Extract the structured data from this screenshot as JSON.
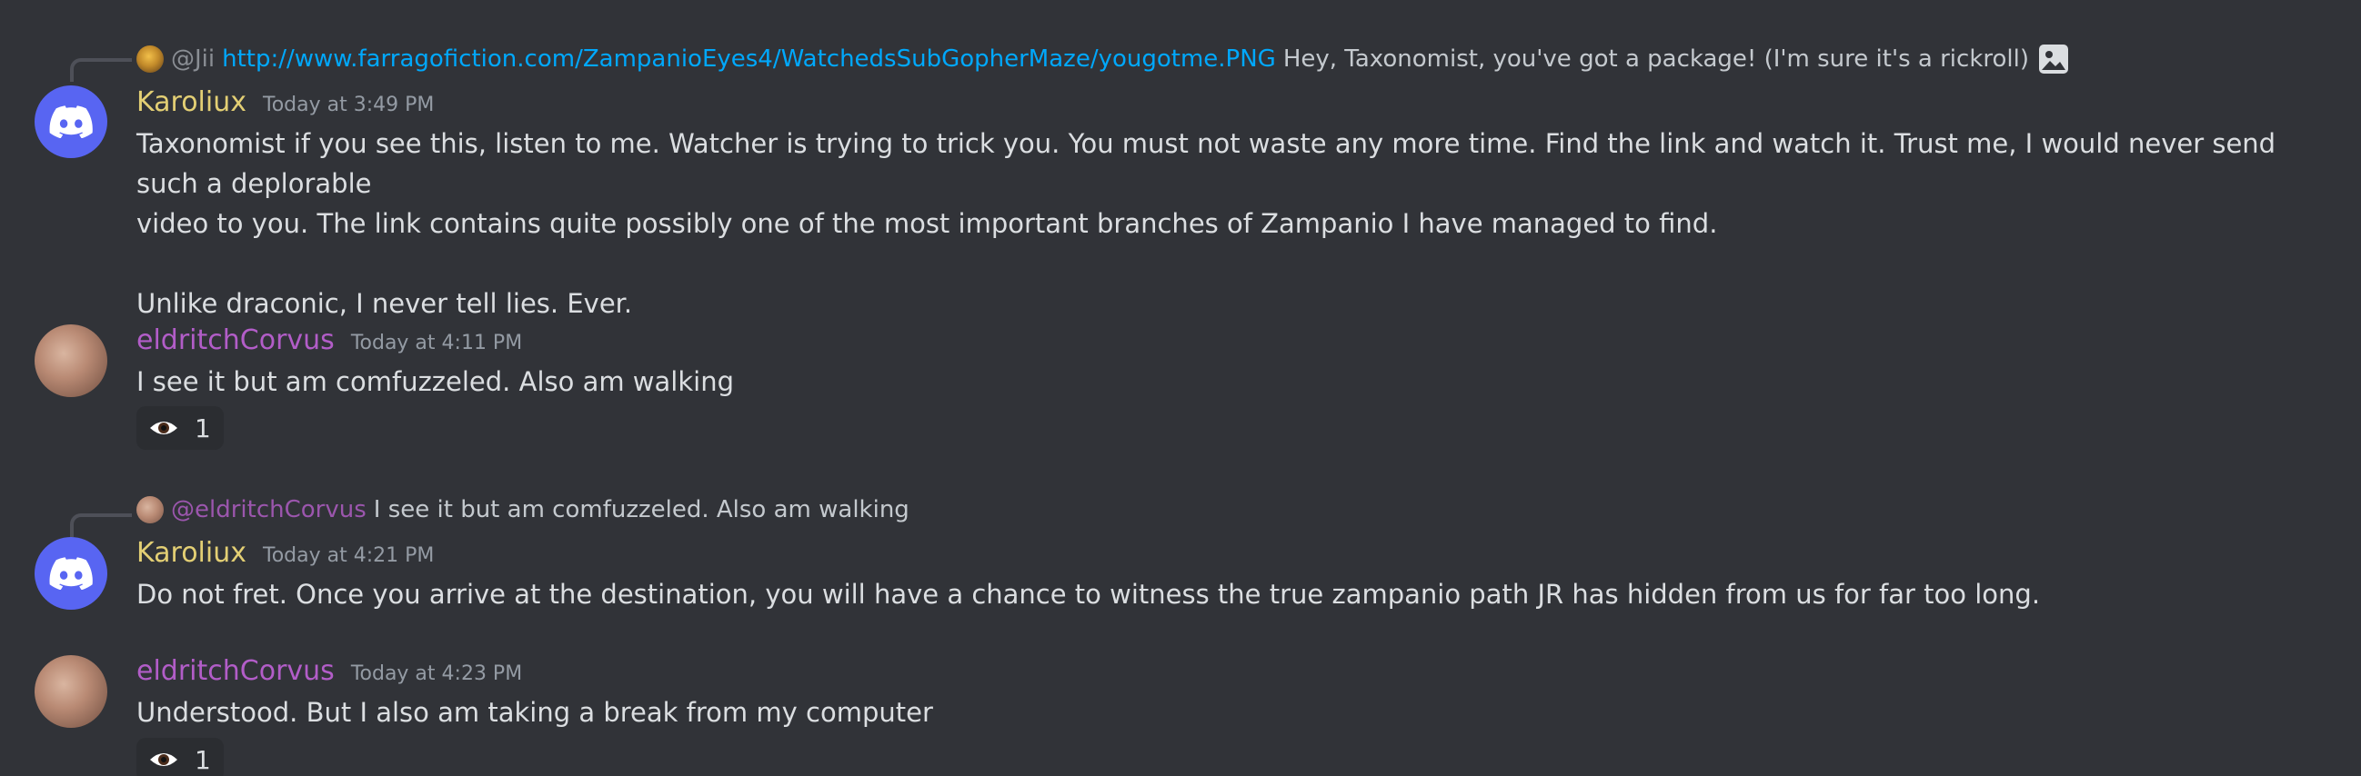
{
  "messages": [
    {
      "reply": {
        "author": "@Jii",
        "link": "http://www.farragofiction.com/ZampanioEyes4/WatchedsSubGopherMaze/yougotme.PNG",
        "text": "Hey, Taxonomist, you've got a package! (I'm sure it's a rickroll)",
        "attachment_icon": "image-icon"
      },
      "author": "Karoliux",
      "timestamp": "Today at 3:49 PM",
      "lines": [
        "Taxonomist if you see this, listen to me. Watcher is trying to trick you. You must not waste any more time. Find the link and watch it. Trust me, I would never send such a deplorable",
        "video to you. The link contains quite possibly one of the most important branches of Zampanio I have managed to find.",
        "",
        "Unlike draconic, I never tell lies. Ever."
      ]
    },
    {
      "author": "eldritchCorvus",
      "timestamp": "Today at 4:11 PM",
      "lines": [
        "I see it but am comfuzzeled. Also am walking"
      ],
      "reaction": {
        "emoji": "eye-icon",
        "count": "1"
      }
    },
    {
      "reply": {
        "author": "@eldritchCorvus",
        "text": "I see it but am comfuzzeled. Also am walking"
      },
      "author": "Karoliux",
      "timestamp": "Today at 4:21 PM",
      "lines": [
        "Do not fret. Once you arrive at the destination, you will have a chance to witness the true zampanio path JR has hidden from us for far too long."
      ]
    },
    {
      "author": "eldritchCorvus",
      "timestamp": "Today at 4:23 PM",
      "lines": [
        "Understood. But I also am taking a break from my computer"
      ],
      "reaction": {
        "emoji": "eye-icon",
        "count": "1"
      }
    }
  ],
  "colors": {
    "background": "#313338",
    "karoliux_name": "#e3cf74",
    "eldritch_name": "#b25dc8",
    "link": "#00a8fc",
    "discord_blurple": "#5865f2"
  }
}
